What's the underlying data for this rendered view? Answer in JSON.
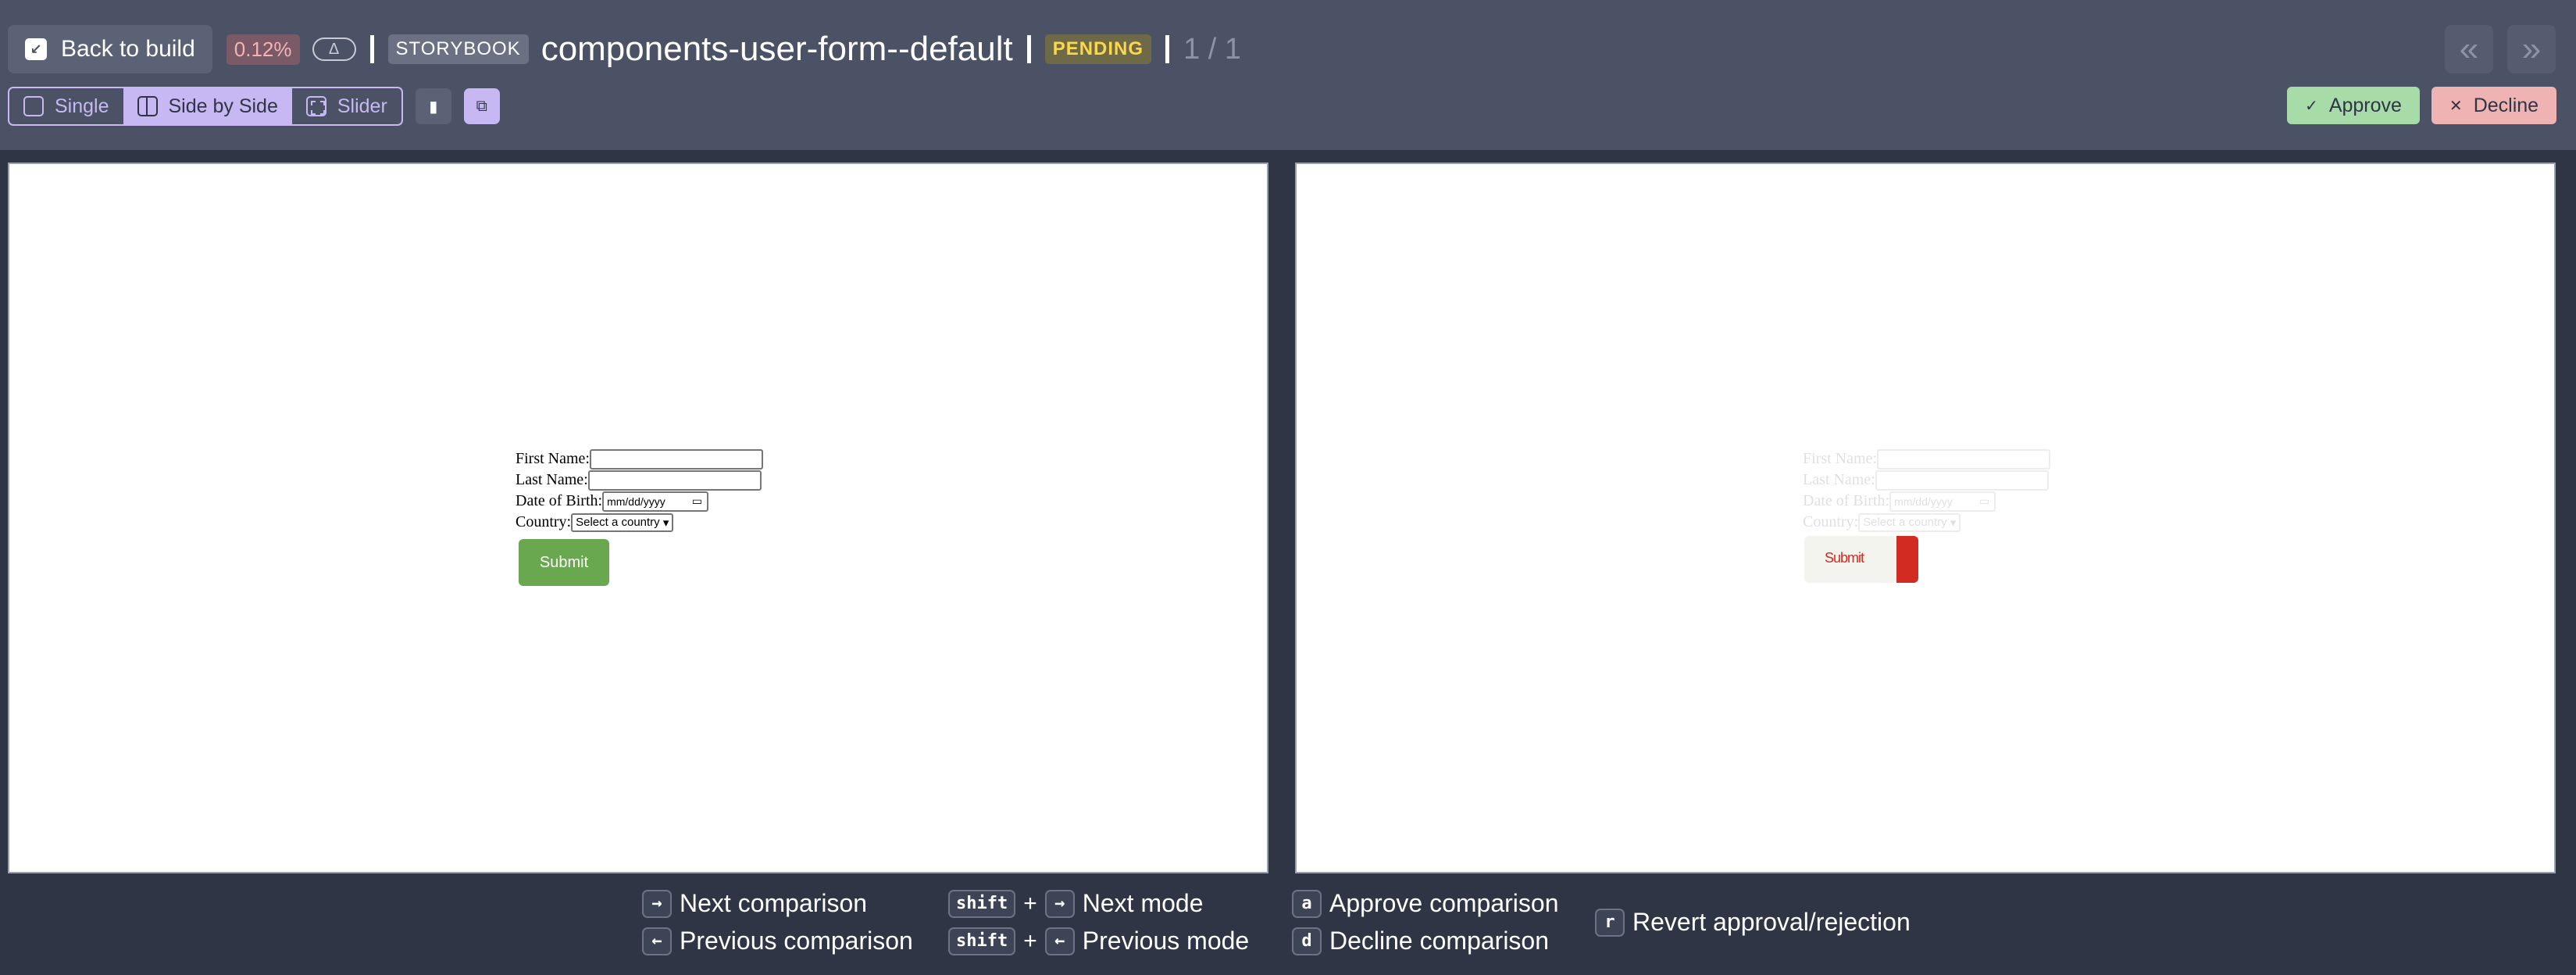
{
  "header": {
    "back_label": "Back to build",
    "diff_percent": "0.12%",
    "delta_symbol": "Δ",
    "source_badge": "STORYBOOK",
    "title": "components-user-form--default",
    "status": "PENDING",
    "position": "1 / 1",
    "prev_label": "«",
    "next_label": "»"
  },
  "toolbar": {
    "modes": [
      {
        "label": "Single",
        "active": false
      },
      {
        "label": "Side by Side",
        "active": true
      },
      {
        "label": "Slider",
        "active": false
      }
    ],
    "approve_label": "Approve",
    "decline_label": "Decline"
  },
  "form": {
    "first_name": "First Name:",
    "last_name": "Last Name:",
    "dob": "Date of Birth:",
    "dob_placeholder": "mm/dd/yyyy",
    "country": "Country:",
    "country_select": "Select a country",
    "submit": "Submit"
  },
  "diff_button_text": "Submit",
  "shortcuts": [
    {
      "keys": [
        "→"
      ],
      "label": "Next comparison"
    },
    {
      "keys": [
        "←"
      ],
      "label": "Previous comparison"
    },
    {
      "keys": [
        "shift",
        "→"
      ],
      "label": "Next mode"
    },
    {
      "keys": [
        "shift",
        "←"
      ],
      "label": "Previous mode"
    },
    {
      "keys": [
        "a"
      ],
      "label": "Approve comparison"
    },
    {
      "keys": [
        "d"
      ],
      "label": "Decline comparison"
    },
    {
      "keys": [
        "r"
      ],
      "label": "Revert approval/rejection"
    }
  ],
  "colors": {
    "header_bg": "#4b5265",
    "page_bg": "#2f3545",
    "accent": "#c7b8f3",
    "approve": "#a7dba8",
    "decline": "#f0b3b3",
    "submit_green": "#6aa84f",
    "diff_red": "#d22c22"
  }
}
